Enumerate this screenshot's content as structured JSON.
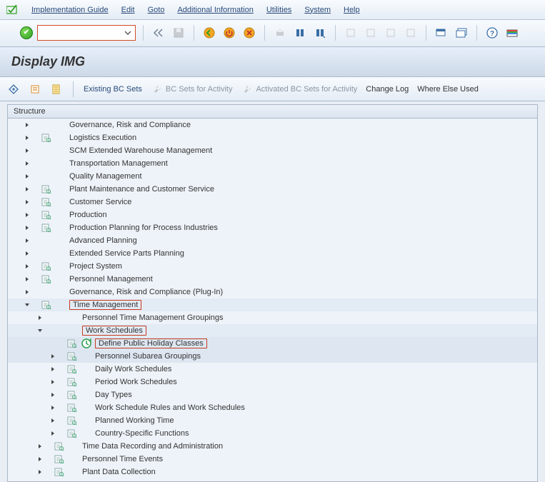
{
  "menu": {
    "items": [
      "Implementation Guide",
      "Edit",
      "Goto",
      "Additional Information",
      "Utilities",
      "System",
      "Help"
    ]
  },
  "title": "Display IMG",
  "subtoolbar": {
    "existing": "Existing BC Sets",
    "for_activity": "BC Sets for Activity",
    "activated": "Activated BC Sets for Activity",
    "changelog": "Change Log",
    "whereused": "Where Else Used"
  },
  "structure_header": "Structure",
  "tree": [
    {
      "d": 1,
      "exp": "r",
      "doc": false,
      "lbl": "Governance, Risk and Compliance"
    },
    {
      "d": 1,
      "exp": "r",
      "doc": true,
      "lbl": "Logistics Execution"
    },
    {
      "d": 1,
      "exp": "r",
      "doc": false,
      "lbl": "SCM Extended Warehouse Management"
    },
    {
      "d": 1,
      "exp": "r",
      "doc": false,
      "lbl": "Transportation Management"
    },
    {
      "d": 1,
      "exp": "r",
      "doc": false,
      "lbl": "Quality Management"
    },
    {
      "d": 1,
      "exp": "r",
      "doc": true,
      "lbl": "Plant Maintenance and Customer Service"
    },
    {
      "d": 1,
      "exp": "r",
      "doc": true,
      "lbl": "Customer Service"
    },
    {
      "d": 1,
      "exp": "r",
      "doc": true,
      "lbl": "Production"
    },
    {
      "d": 1,
      "exp": "r",
      "doc": true,
      "lbl": "Production Planning for Process Industries"
    },
    {
      "d": 1,
      "exp": "r",
      "doc": false,
      "lbl": "Advanced Planning"
    },
    {
      "d": 1,
      "exp": "r",
      "doc": false,
      "lbl": "Extended Service Parts Planning"
    },
    {
      "d": 1,
      "exp": "r",
      "doc": true,
      "lbl": "Project System"
    },
    {
      "d": 1,
      "exp": "r",
      "doc": true,
      "lbl": "Personnel Management"
    },
    {
      "d": 1,
      "exp": "r",
      "doc": false,
      "lbl": "Governance, Risk and Compliance (Plug-In)"
    },
    {
      "d": 1,
      "exp": "d",
      "doc": true,
      "lbl": "Time Management",
      "hl": true,
      "shade": 1
    },
    {
      "d": 2,
      "exp": "r",
      "doc": false,
      "lbl": "Personnel Time Management Groupings"
    },
    {
      "d": 2,
      "exp": "d",
      "doc": false,
      "lbl": "Work Schedules",
      "hl": true,
      "shade": 1
    },
    {
      "d": 3,
      "exp": "",
      "doc": true,
      "clock": true,
      "lbl": "Define Public Holiday Classes",
      "hl": true,
      "shade": 2
    },
    {
      "d": 3,
      "exp": "r",
      "doc": true,
      "lbl": "Personnel Subarea Groupings",
      "shade": 2
    },
    {
      "d": 3,
      "exp": "r",
      "doc": true,
      "lbl": "Daily Work Schedules"
    },
    {
      "d": 3,
      "exp": "r",
      "doc": true,
      "lbl": "Period Work Schedules"
    },
    {
      "d": 3,
      "exp": "r",
      "doc": true,
      "lbl": "Day Types"
    },
    {
      "d": 3,
      "exp": "r",
      "doc": true,
      "lbl": "Work Schedule Rules and Work Schedules"
    },
    {
      "d": 3,
      "exp": "r",
      "doc": true,
      "lbl": "Planned Working Time"
    },
    {
      "d": 3,
      "exp": "r",
      "doc": true,
      "lbl": "Country-Specific Functions"
    },
    {
      "d": 2,
      "exp": "r",
      "doc": true,
      "lbl": "Time Data Recording and Administration"
    },
    {
      "d": 2,
      "exp": "r",
      "doc": true,
      "lbl": "Personnel Time Events"
    },
    {
      "d": 2,
      "exp": "r",
      "doc": true,
      "lbl": "Plant Data Collection"
    }
  ]
}
